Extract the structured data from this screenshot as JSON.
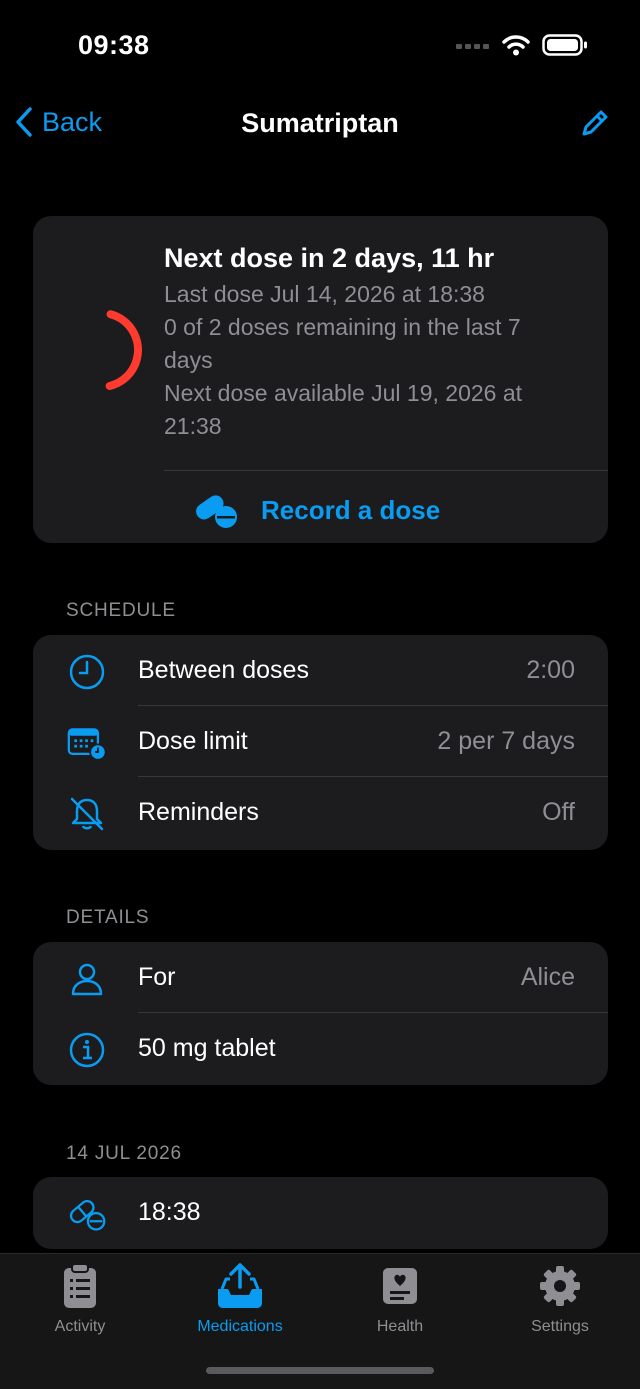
{
  "status_bar": {
    "time": "09:38"
  },
  "nav": {
    "back_label": "Back",
    "title": "Sumatriptan"
  },
  "summary": {
    "title": "Next dose in 2 days, 11 hr",
    "last_dose": "Last dose Jul 14, 2026 at 18:38",
    "remaining": "0 of 2 doses remaining in the last 7 days",
    "next_available": "Next dose available Jul 19, 2026 at 21:38",
    "record_label": "Record a dose",
    "ring_color": "#ff3b30",
    "ring_fraction": 0.42
  },
  "schedule": {
    "header": "SCHEDULE",
    "rows": [
      {
        "icon": "clock-icon",
        "label": "Between doses",
        "value": "2:00"
      },
      {
        "icon": "calendar-clock-icon",
        "label": "Dose limit",
        "value": "2 per 7 days"
      },
      {
        "icon": "bell-slash-icon",
        "label": "Reminders",
        "value": "Off"
      }
    ]
  },
  "details": {
    "header": "DETAILS",
    "rows": [
      {
        "icon": "person-icon",
        "label": "For",
        "value": "Alice"
      },
      {
        "icon": "info-icon",
        "label": "50 mg tablet",
        "value": ""
      }
    ]
  },
  "history": {
    "header": "14 JUL 2026",
    "rows": [
      {
        "icon": "pill-icon",
        "label": "18:38"
      }
    ]
  },
  "tabs": [
    {
      "label": "Activity",
      "icon": "clipboard-icon",
      "active": false
    },
    {
      "label": "Medications",
      "icon": "tray-upload-icon",
      "active": true
    },
    {
      "label": "Health",
      "icon": "health-card-icon",
      "active": false
    },
    {
      "label": "Settings",
      "icon": "gear-icon",
      "active": false
    }
  ],
  "colors": {
    "accent": "#0a9cf0",
    "background": "#000000",
    "card": "#1c1c1e",
    "secondary_text": "#8e8e93"
  }
}
